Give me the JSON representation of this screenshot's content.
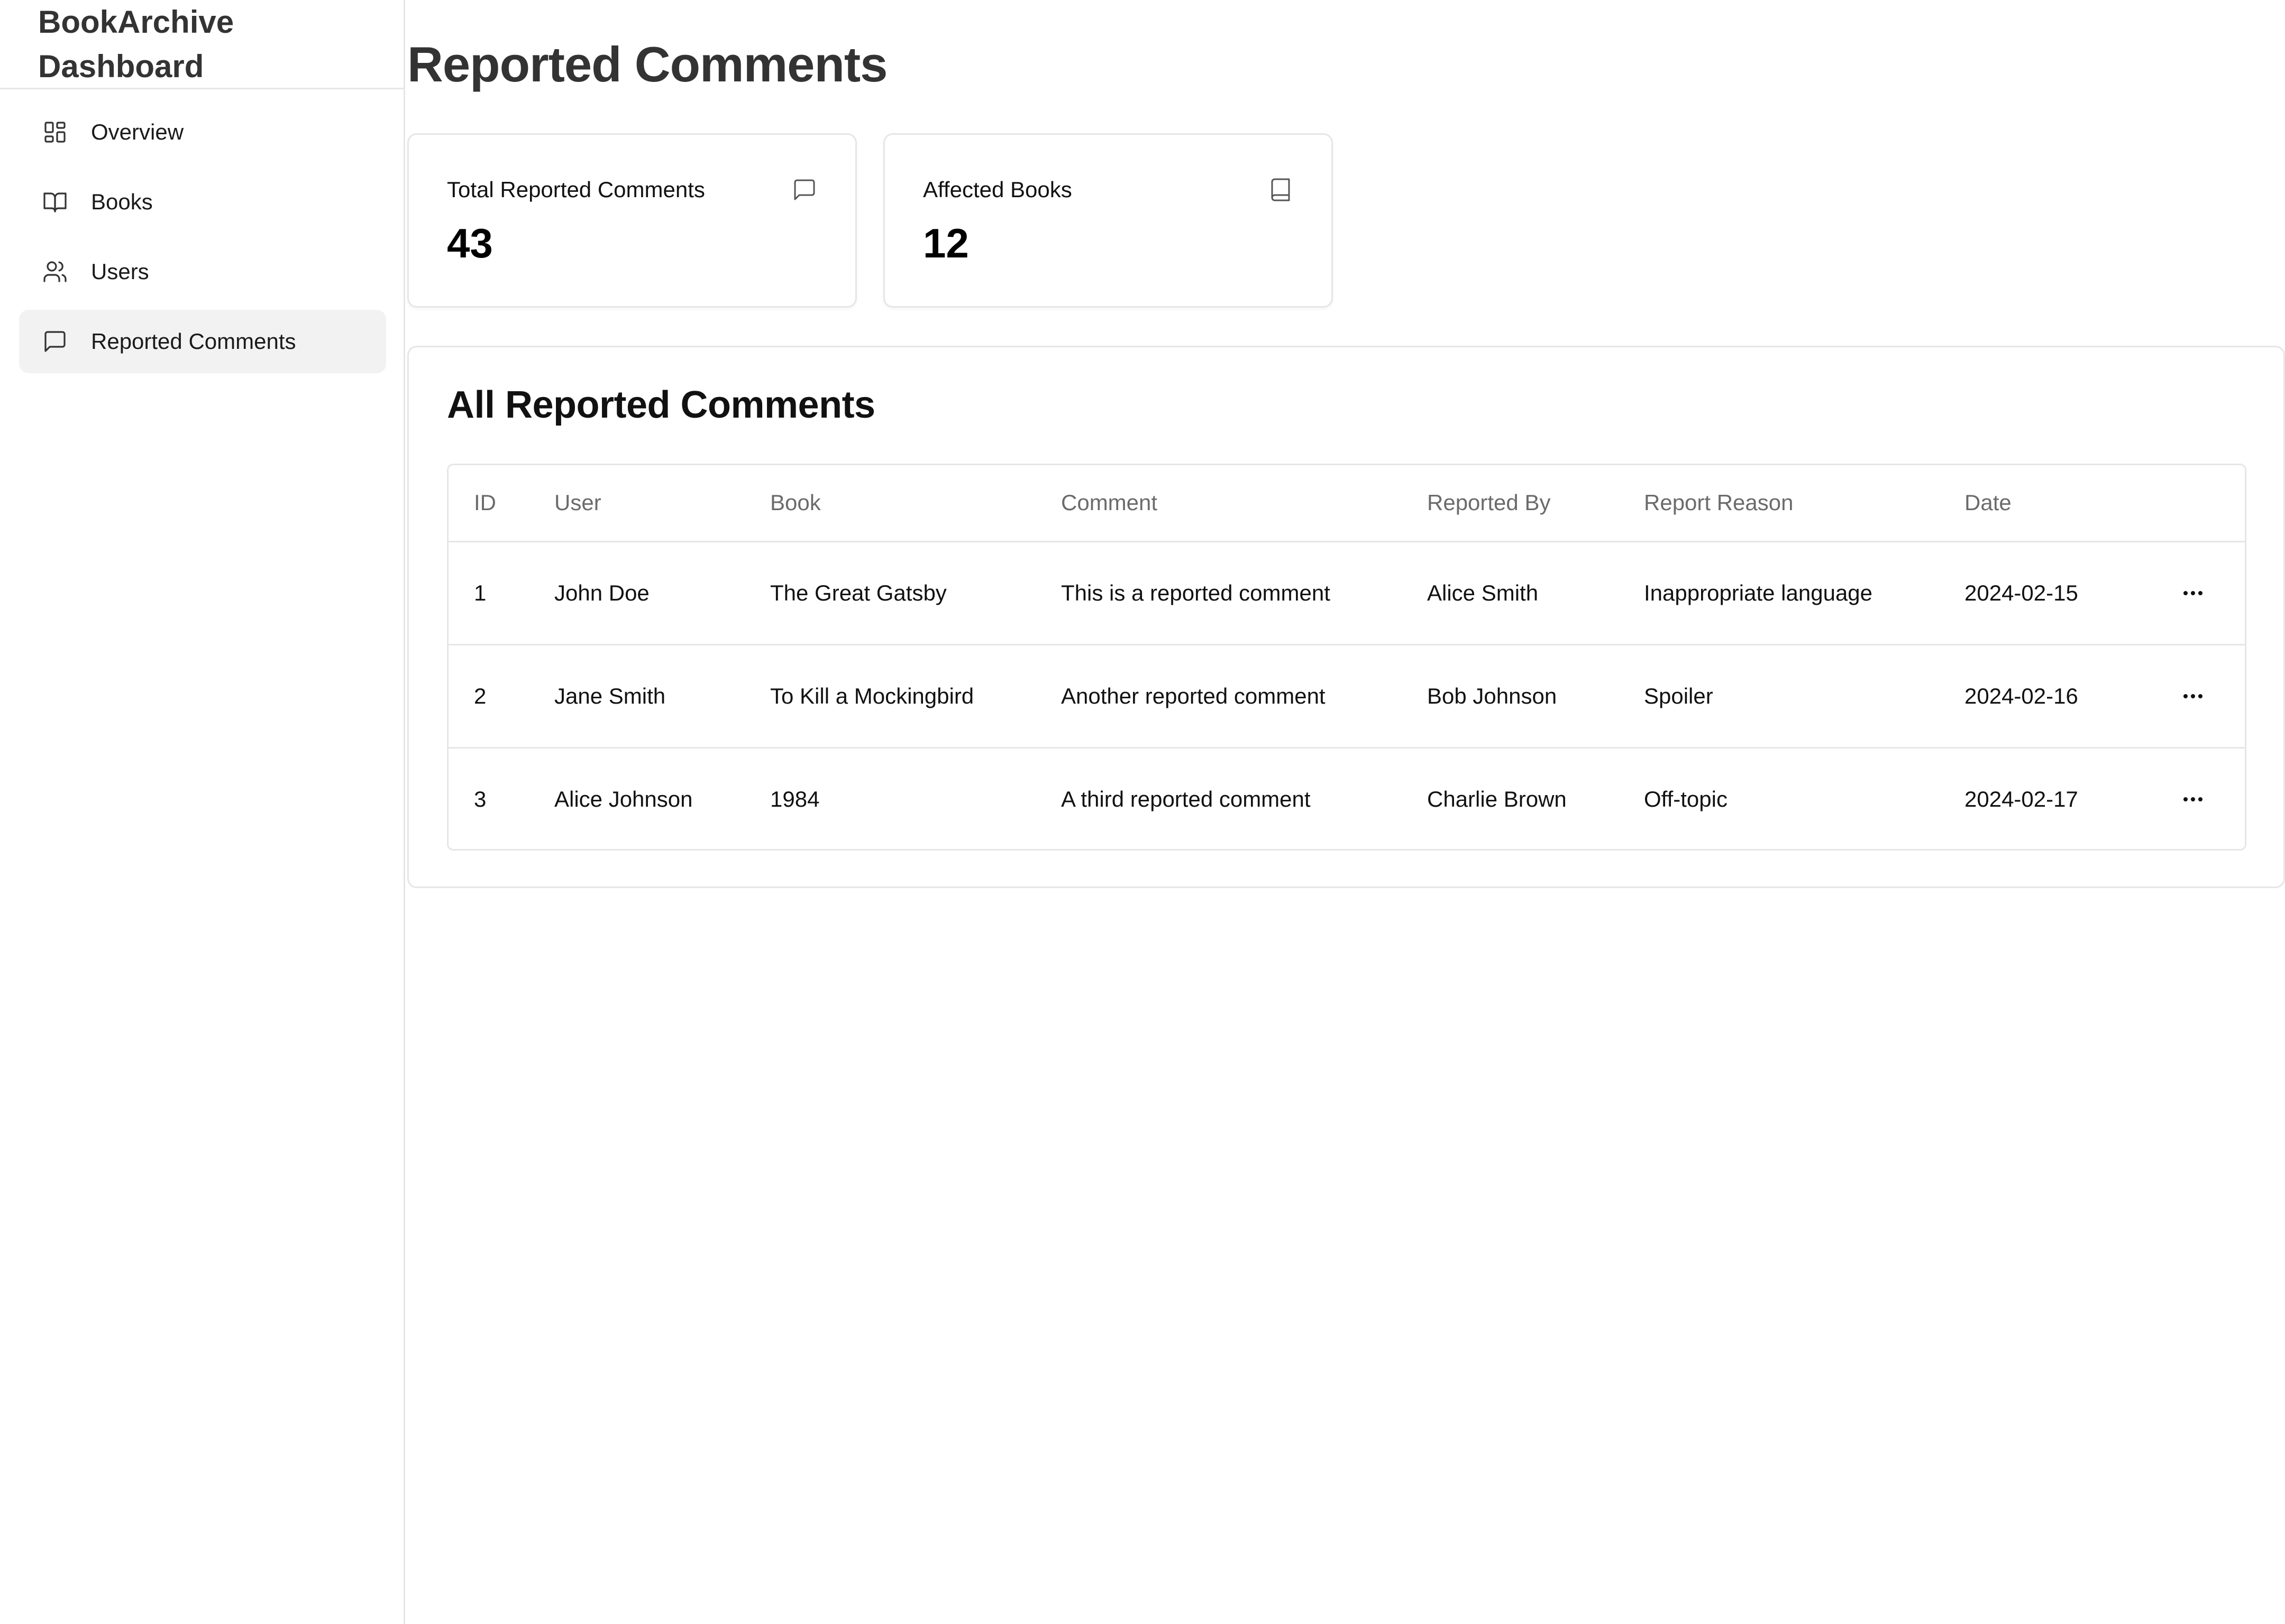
{
  "app": {
    "brand_line1": "BookArchive",
    "brand_line2": "Dashboard"
  },
  "sidebar": {
    "items": [
      {
        "label": "Overview",
        "icon": "dashboard-icon",
        "active": false
      },
      {
        "label": "Books",
        "icon": "book-open-icon",
        "active": false
      },
      {
        "label": "Users",
        "icon": "users-icon",
        "active": false
      },
      {
        "label": "Reported Comments",
        "icon": "message-square-icon",
        "active": true
      }
    ]
  },
  "page": {
    "title": "Reported Comments"
  },
  "stats": [
    {
      "label": "Total Reported Comments",
      "value": "43",
      "icon": "message-square-icon"
    },
    {
      "label": "Affected Books",
      "value": "12",
      "icon": "book-icon"
    }
  ],
  "table": {
    "title": "All Reported Comments",
    "headers": [
      "ID",
      "User",
      "Book",
      "Comment",
      "Reported By",
      "Report Reason",
      "Date"
    ],
    "rows": [
      {
        "id": "1",
        "user": "John Doe",
        "book": "The Great Gatsby",
        "comment": "This is a reported comment",
        "reported_by": "Alice Smith",
        "reason": "Inappropriate language",
        "date": "2024-02-15"
      },
      {
        "id": "2",
        "user": "Jane Smith",
        "book": "To Kill a Mockingbird",
        "comment": "Another reported comment",
        "reported_by": "Bob Johnson",
        "reason": "Spoiler",
        "date": "2024-02-16"
      },
      {
        "id": "3",
        "user": "Alice Johnson",
        "book": "1984",
        "comment": "A third reported comment",
        "reported_by": "Charlie Brown",
        "reason": "Off-topic",
        "date": "2024-02-17"
      }
    ]
  },
  "colors": {
    "active_nav_bg": "#f2f2f2",
    "border": "#e6e6e6",
    "muted_text": "#6b6b6b",
    "heading_text": "#333333"
  }
}
